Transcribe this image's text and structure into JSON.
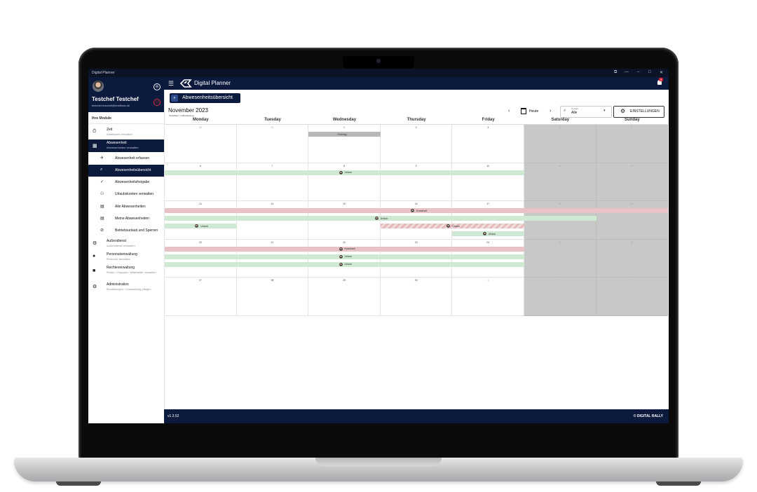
{
  "window": {
    "title": "Digital Planner"
  },
  "profile": {
    "name": "Testchef Testchef",
    "email": "testchef.testchef@testfirma.de"
  },
  "sidebar": {
    "heading": "Ihre Module",
    "items": [
      {
        "title": "Zeit",
        "subtitle": "Arbeitszeit verwalten"
      },
      {
        "title": "Abwesenheit",
        "subtitle": "Abwesenheiten verwalten"
      },
      {
        "title": "Außendienst",
        "subtitle": "Außendienst verwalten"
      },
      {
        "title": "Personalverwaltung",
        "subtitle": "Personal verwalten"
      },
      {
        "title": "Rechteverwaltung",
        "subtitle": "Rollen / Gruppen / Mitarbeiter verwalten"
      },
      {
        "title": "Administration",
        "subtitle": "Einstellungen / Customizing pflegen"
      }
    ],
    "children": [
      "Abwesenheit erfassen",
      "Abwesenheitsübersicht",
      "Abwesenheitsfreigabe",
      "Urlaubskonten verwalten",
      "Alle Abwesenheiten",
      "Meine Abwesenheiten",
      "Betriebsurlaub und Sperren"
    ]
  },
  "topbar": {
    "app_title": "Digital Planner",
    "notification_count": "3"
  },
  "page": {
    "title": "Abwesenheitsübersicht",
    "month": "November 2023",
    "legend": "Testeffekt = in Bearbeitung",
    "today_label": "Heute",
    "group_label": "Gruppe",
    "group_value": "Alle",
    "settings_label": "EINSTELLUNGEN"
  },
  "calendar": {
    "weekdays": [
      "Monday",
      "Tuesday",
      "Wednesday",
      "Thursday",
      "Friday",
      "Saturday",
      "Sunday"
    ],
    "weeks": [
      [
        "30",
        "31",
        "1",
        "2",
        "3",
        "4",
        "5"
      ],
      [
        "6",
        "7",
        "8",
        "9",
        "10",
        "11",
        "12"
      ],
      [
        "13",
        "14",
        "15",
        "16",
        "17",
        "18",
        "19"
      ],
      [
        "20",
        "21",
        "22",
        "23",
        "24",
        "25",
        "26"
      ],
      [
        "27",
        "28",
        "29",
        "30",
        "1",
        "2",
        "3"
      ]
    ],
    "events": [
      {
        "week": 0,
        "start": 2,
        "span": 1,
        "lane": 0,
        "label": "Feiertag",
        "type": "gray"
      },
      {
        "week": 1,
        "start": 0,
        "span": 5,
        "lane": 0,
        "label": "Urlaub",
        "type": "green",
        "avatar": true
      },
      {
        "week": 2,
        "start": 0,
        "span": 7,
        "lane": 0,
        "label": "Krankheit",
        "type": "red",
        "avatar": true
      },
      {
        "week": 2,
        "start": 0,
        "span": 6,
        "lane": 1,
        "label": "Urlaub",
        "type": "green",
        "avatar": true
      },
      {
        "week": 2,
        "start": 0,
        "span": 1,
        "lane": 2,
        "label": "Urlaub",
        "type": "green",
        "avatar": true
      },
      {
        "week": 2,
        "start": 3,
        "span": 2,
        "lane": 2,
        "label": "Urlaub",
        "type": "hatch",
        "avatar": true
      },
      {
        "week": 2,
        "start": 4,
        "span": 1,
        "lane": 3,
        "label": "Urlaub",
        "type": "green",
        "avatar": true
      },
      {
        "week": 3,
        "start": 0,
        "span": 5,
        "lane": 0,
        "label": "Krankheit",
        "type": "red",
        "avatar": true
      },
      {
        "week": 3,
        "start": 0,
        "span": 5,
        "lane": 1,
        "label": "Urlaub",
        "type": "green",
        "avatar": true
      },
      {
        "week": 3,
        "start": 0,
        "span": 5,
        "lane": 2,
        "label": "Urlaub",
        "type": "green",
        "avatar": true
      }
    ]
  },
  "footer": {
    "version": "v1.3.52",
    "copyright": "© DIGITAL RALLY"
  }
}
